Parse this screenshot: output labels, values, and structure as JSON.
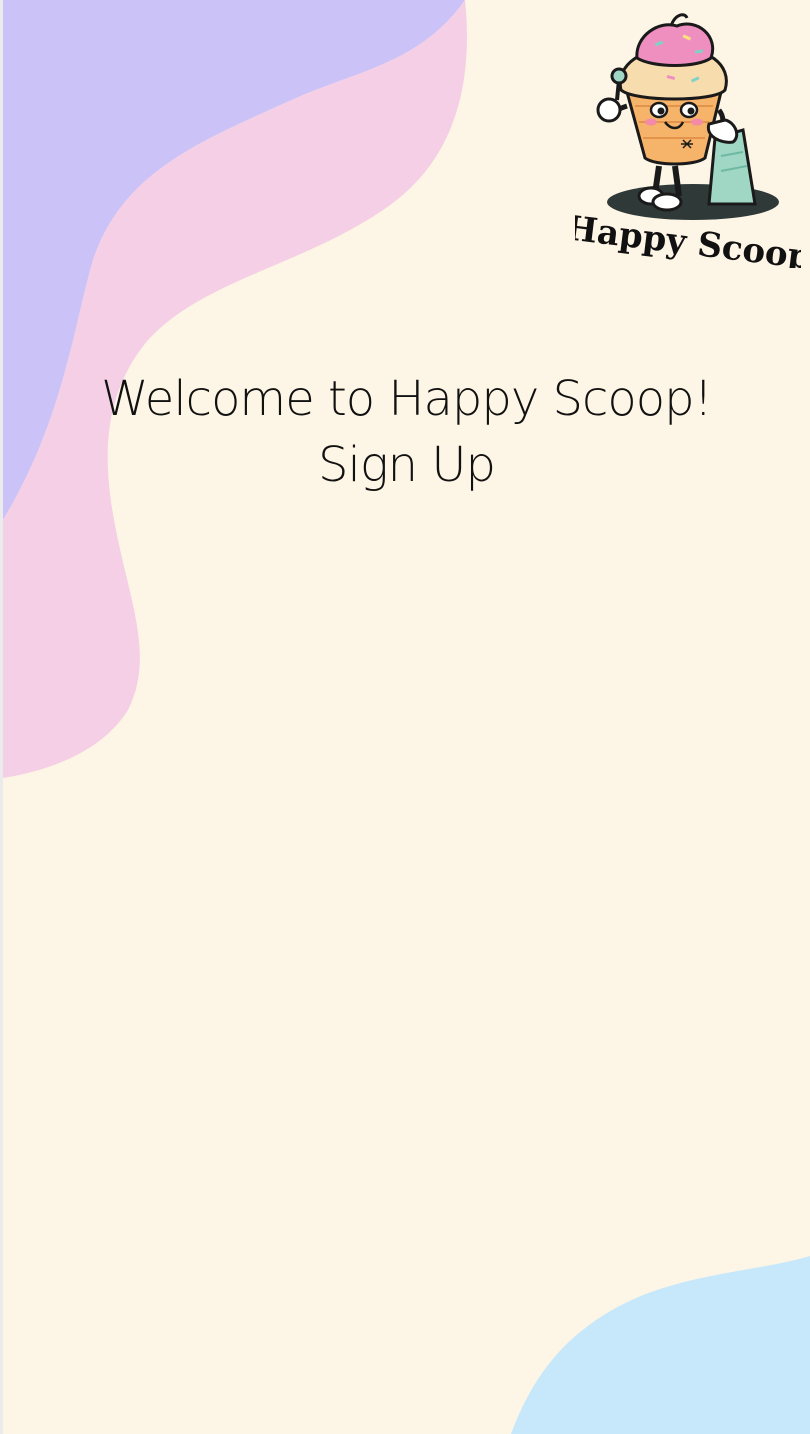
{
  "brand": {
    "name": "Happy Scoop",
    "logo_icon": "ice-cream-mascot-icon"
  },
  "main": {
    "welcome_title": "Welcome to Happy Scoop!",
    "signup_label": "Sign Up"
  },
  "colors": {
    "background": "#fdf5e5",
    "blob_purple": "#cbc3f8",
    "blob_pink": "#f5cfe6",
    "blob_blue": "#c7e8fb",
    "text": "#111111"
  }
}
